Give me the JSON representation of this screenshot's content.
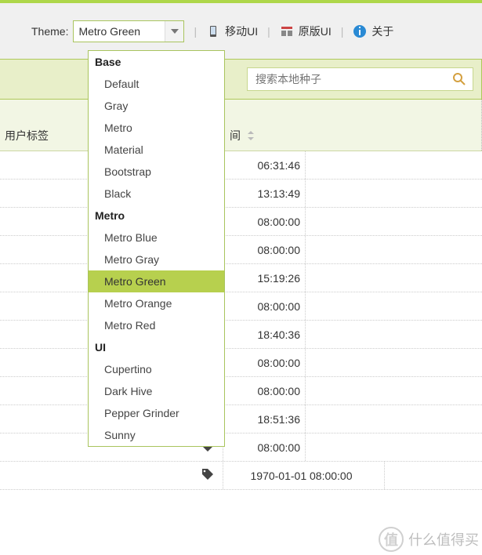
{
  "topbar": {
    "theme_label": "Theme:",
    "theme_value": "Metro Green",
    "mobile_ui": "移动UI",
    "original_ui": "原版UI",
    "about": "关于"
  },
  "search": {
    "placeholder": "搜索本地种子"
  },
  "headers": {
    "user_label": "用户标签",
    "time_suffix": "间"
  },
  "dropdown": {
    "groups": [
      {
        "name": "Base",
        "options": [
          "Default",
          "Gray",
          "Metro",
          "Material",
          "Bootstrap",
          "Black"
        ]
      },
      {
        "name": "Metro",
        "options": [
          "Metro Blue",
          "Metro Gray",
          "Metro Green",
          "Metro Orange",
          "Metro Red"
        ]
      },
      {
        "name": "UI",
        "options": [
          "Cupertino",
          "Dark Hive",
          "Pepper Grinder",
          "Sunny"
        ]
      }
    ],
    "selected": "Metro Green"
  },
  "rows": [
    {
      "time": "06:31:46"
    },
    {
      "time": "13:13:49"
    },
    {
      "time": "08:00:00"
    },
    {
      "time": "08:00:00"
    },
    {
      "time": "15:19:26"
    },
    {
      "time": "08:00:00"
    },
    {
      "time": "18:40:36"
    },
    {
      "time": "08:00:00"
    },
    {
      "time": "08:00:00"
    },
    {
      "time": "18:51:36"
    },
    {
      "time": "08:00:00"
    }
  ],
  "last_row": {
    "time": "1970-01-01 08:00:00"
  },
  "watermark": {
    "logo": "值",
    "text": "什么值得买"
  }
}
